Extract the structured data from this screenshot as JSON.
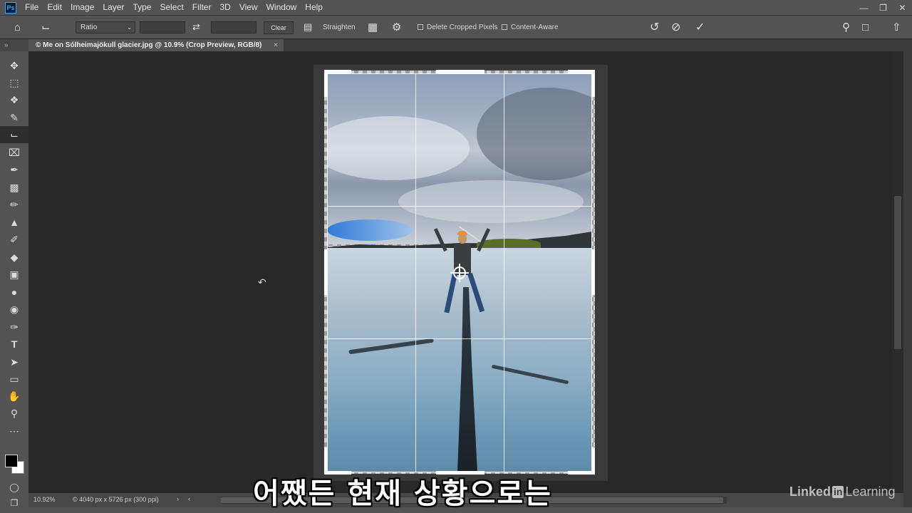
{
  "menubar": {
    "logo": "Ps",
    "items": [
      "File",
      "Edit",
      "Image",
      "Layer",
      "Type",
      "Select",
      "Filter",
      "3D",
      "View",
      "Window",
      "Help"
    ]
  },
  "options": {
    "ratio_label": "Ratio",
    "clear_label": "Clear",
    "straighten_label": "Straighten",
    "delete_cropped_label": "Delete Cropped Pixels",
    "content_aware_label": "Content-Aware"
  },
  "document": {
    "tab_title": "© Me on Sólheimajökull glacier.jpg @ 10.9% (Crop Preview, RGB/8)"
  },
  "status": {
    "zoom": "10.92%",
    "doc_info": "© 4040 px x 5726 px (300 ppi)"
  },
  "subtitle": "어쨌든 현재 상황으로는",
  "watermark": {
    "linked": "Linked",
    "in": "in",
    "learning": "Learning"
  },
  "colors": {
    "ps_accent": "#31a8ff",
    "ui_panel": "#535353",
    "canvas_bg": "#282828"
  },
  "tools": [
    "move-icon",
    "marquee-icon",
    "lasso-icon",
    "quick-select-icon",
    "crop-icon",
    "frame-icon",
    "eyedropper-icon",
    "healing-icon",
    "brush-icon",
    "stamp-icon",
    "history-brush-icon",
    "eraser-icon",
    "gradient-icon",
    "blur-icon",
    "dodge-icon",
    "pen-icon",
    "type-icon",
    "path-select-icon",
    "rectangle-icon",
    "hand-icon",
    "zoom-icon",
    "more-icon"
  ]
}
